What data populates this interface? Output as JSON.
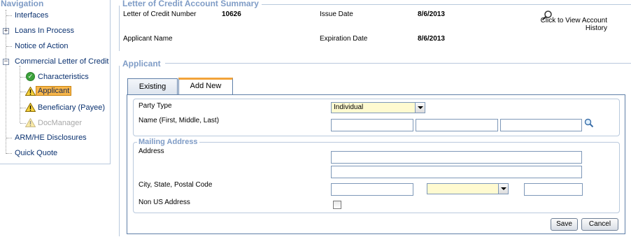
{
  "navigation": {
    "title": "Navigation",
    "items": [
      {
        "label": "Interfaces"
      },
      {
        "label": "Loans In Process"
      },
      {
        "label": "Notice of Action"
      },
      {
        "label": "Commercial Letter of Credit"
      },
      {
        "label": "Characteristics"
      },
      {
        "label": "Applicant"
      },
      {
        "label": "Beneficiary (Payee)"
      },
      {
        "label": "DocManager"
      },
      {
        "label": "ARM/HE Disclosures"
      },
      {
        "label": "Quick Quote"
      }
    ]
  },
  "summary": {
    "title": "Letter of Credit Account Summary",
    "loc_number_label": "Letter of Credit Number",
    "loc_number_value": "10626",
    "issue_date_label": "Issue Date",
    "issue_date_value": "8/6/2013",
    "applicant_name_label": "Applicant Name",
    "expiration_date_label": "Expiration Date",
    "expiration_date_value": "8/6/2013",
    "history_link_line1": "Click to View Account",
    "history_link_line2": "History"
  },
  "applicant": {
    "title": "Applicant",
    "tabs": [
      {
        "label": "Existing"
      },
      {
        "label": "Add New"
      }
    ],
    "party_type_label": "Party Type",
    "party_type_value": "Individual",
    "name_label": "Name (First, Middle, Last)",
    "mailing_title": "Mailing Address",
    "address_label": "Address",
    "city_label": "City, State, Postal Code",
    "non_us_label": "Non US Address",
    "save_label": "Save",
    "cancel_label": "Cancel"
  },
  "colors": {
    "section_title": "#7f9cc6",
    "nav_link": "#0b3270",
    "selected_bg": "#f7b64a",
    "tab_accent": "#f2a33a",
    "select_bg": "#fffad0"
  }
}
